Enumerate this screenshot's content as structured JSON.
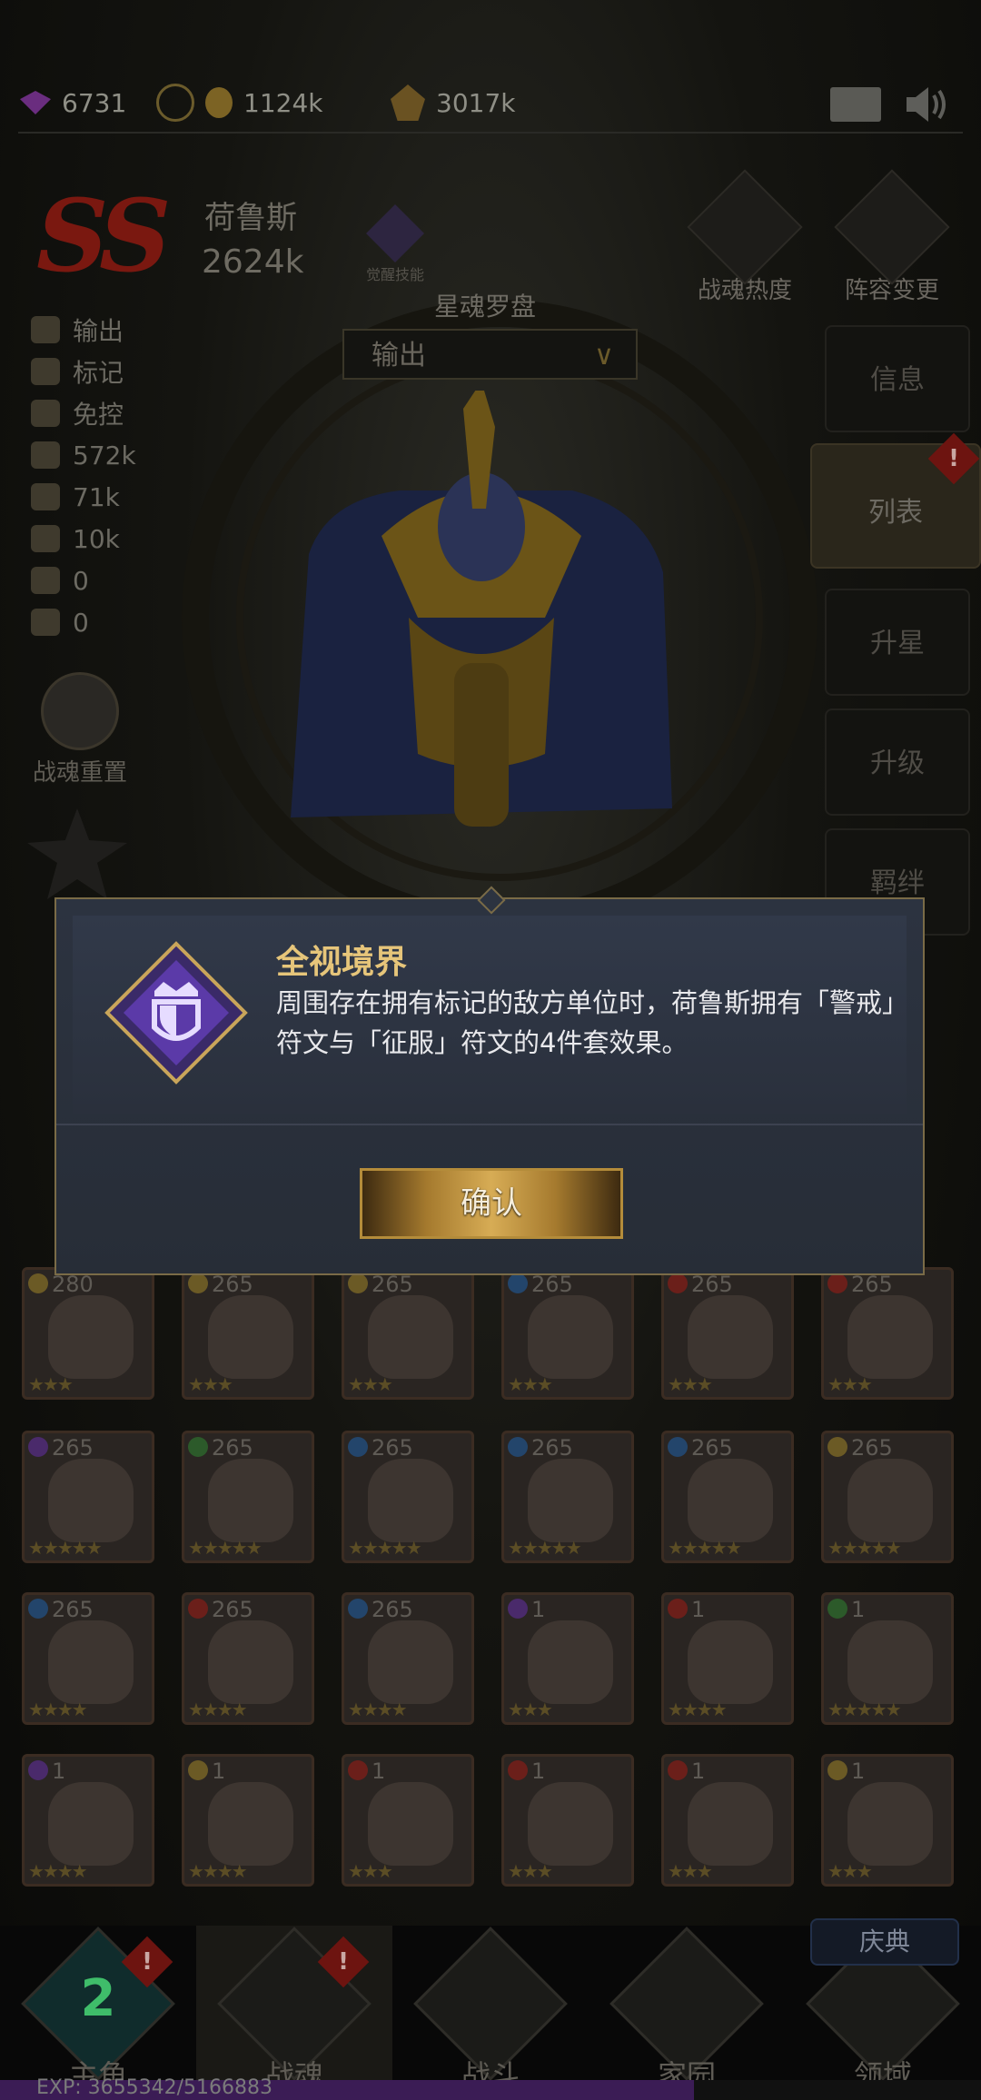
{
  "header": {
    "gems": "6731",
    "gold": "1124k",
    "exp": "3017k",
    "exp_icon_label": "EXP"
  },
  "hero": {
    "grade": "SS",
    "name": "荷鲁斯",
    "power": "2624k",
    "awaken_label": "觉醒技能",
    "stats": {
      "role": "输出",
      "tag": "标记",
      "control": "免控",
      "hp": "572k",
      "attack": "71k",
      "defense": "10k",
      "stat_a": "0",
      "stat_b": "0"
    },
    "reset_label": "战魂重置"
  },
  "compass": {
    "title": "星魂罗盘",
    "selected": "输出"
  },
  "side": {
    "heat": "战魂热度",
    "lineup": "阵容变更",
    "menu": [
      "信息",
      "列表",
      "升星",
      "升级",
      "羁绊"
    ]
  },
  "dialog": {
    "title": "全视境界",
    "description": "周围存在拥有标记的敌方单位时，荷鲁斯拥有「警戒」符文与「征服」符文的4件套效果。",
    "confirm": "确认"
  },
  "roster_cards": [
    {
      "lv": "280",
      "stars": "★★★",
      "el": "#6b5a25"
    },
    {
      "lv": "265",
      "stars": "★★★",
      "el": "#6b5a25"
    },
    {
      "lv": "265",
      "stars": "★★★",
      "el": "#6b5a25"
    },
    {
      "lv": "265",
      "stars": "★★★",
      "el": "#23456b"
    },
    {
      "lv": "265",
      "stars": "★★★",
      "el": "#6b1f1a"
    },
    {
      "lv": "265",
      "stars": "★★★",
      "el": "#6b1f1a"
    },
    {
      "lv": "265",
      "stars": "★★★★★",
      "el": "#4a2a6b"
    },
    {
      "lv": "265",
      "stars": "★★★★★",
      "el": "#2c5a2a"
    },
    {
      "lv": "265",
      "stars": "★★★★★",
      "el": "#23456b"
    },
    {
      "lv": "265",
      "stars": "★★★★★",
      "el": "#23456b"
    },
    {
      "lv": "265",
      "stars": "★★★★★",
      "el": "#23456b"
    },
    {
      "lv": "265",
      "stars": "★★★★★",
      "el": "#6b5a25"
    },
    {
      "lv": "265",
      "stars": "★★★★",
      "el": "#23456b"
    },
    {
      "lv": "265",
      "stars": "★★★★",
      "el": "#6b1f1a"
    },
    {
      "lv": "265",
      "stars": "★★★★",
      "el": "#23456b"
    },
    {
      "lv": "1",
      "stars": "★★★",
      "el": "#4a2a6b"
    },
    {
      "lv": "1",
      "stars": "★★★★",
      "el": "#6b1f1a"
    },
    {
      "lv": "1",
      "stars": "★★★★★",
      "el": "#2c5a2a"
    },
    {
      "lv": "1",
      "stars": "★★★★",
      "el": "#4a2a6b"
    },
    {
      "lv": "1",
      "stars": "★★★★",
      "el": "#6b5a25"
    },
    {
      "lv": "1",
      "stars": "★★★",
      "el": "#6b1f1a"
    },
    {
      "lv": "1",
      "stars": "★★★",
      "el": "#6b1f1a"
    },
    {
      "lv": "1",
      "stars": "★★★",
      "el": "#6b1f1a"
    },
    {
      "lv": "1",
      "stars": "★★★",
      "el": "#6b5a25"
    }
  ],
  "nav": {
    "items": [
      "主角",
      "战魂",
      "战斗",
      "家园",
      "领域"
    ],
    "level": "2",
    "festival": "庆典",
    "badge": "!"
  },
  "exp_bar": {
    "text": "EXP: 3655342/5166883",
    "progress": 0.7074
  }
}
